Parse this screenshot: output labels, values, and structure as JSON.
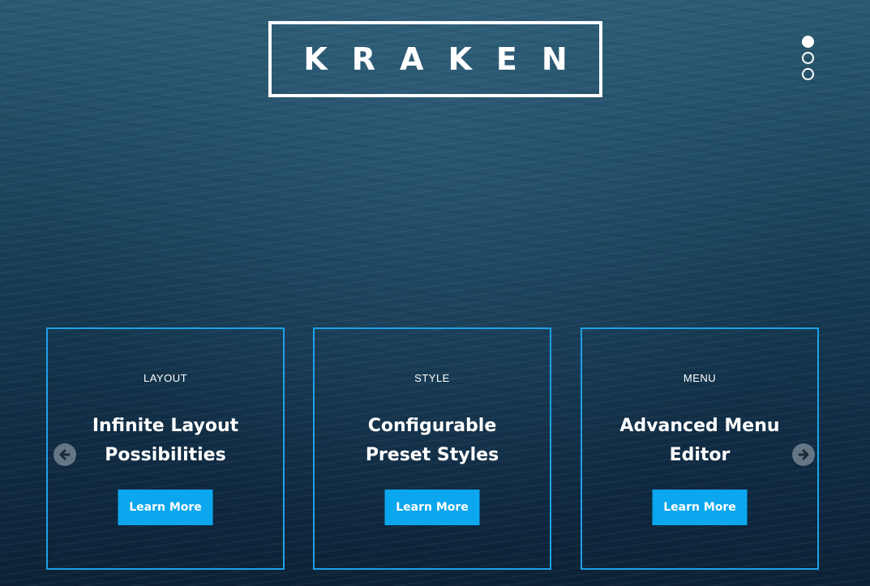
{
  "hero": {
    "logo_text": "KRAKEN"
  },
  "slider_dots": {
    "count": 3,
    "active_index": 0
  },
  "cards": [
    {
      "category": "LAYOUT",
      "title_line1": "Infinite Layout",
      "title_line2": "Possibilities",
      "button_label": "Learn More"
    },
    {
      "category": "STYLE",
      "title_line1": "Configurable",
      "title_line2": "Preset Styles",
      "button_label": "Learn More"
    },
    {
      "category": "MENU",
      "title_line1": "Advanced Menu",
      "title_line2": "Editor",
      "button_label": "Learn More"
    }
  ],
  "carousel": {
    "prev_icon": "arrow-left-icon",
    "next_icon": "arrow-right-icon"
  },
  "colors": {
    "accent": "#1ea1e8",
    "button": "#0aa6ee",
    "text": "#ffffff",
    "background": "#163a53"
  }
}
